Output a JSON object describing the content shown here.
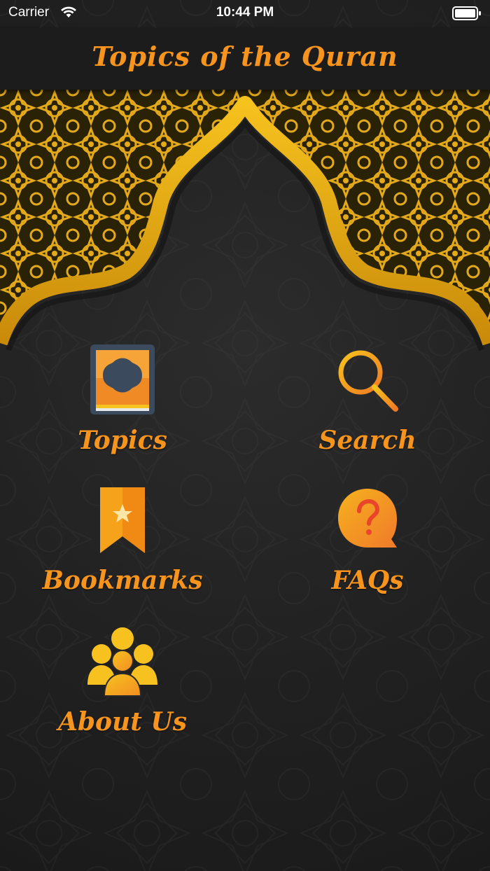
{
  "status_bar": {
    "carrier": "Carrier",
    "time": "10:44 PM",
    "wifi_icon": "wifi-icon",
    "battery_icon": "battery-icon"
  },
  "nav": {
    "title": "Topics of the Quran"
  },
  "menu": {
    "items": [
      {
        "label": "Topics",
        "icon": "book-icon"
      },
      {
        "label": "Search",
        "icon": "search-icon"
      },
      {
        "label": "Bookmarks",
        "icon": "bookmark-icon"
      },
      {
        "label": "FAQs",
        "icon": "question-bubble-icon"
      },
      {
        "label": "About Us",
        "icon": "people-icon"
      }
    ]
  },
  "colors": {
    "accent": "#f7941d",
    "gold": "#e8b020",
    "background": "#222222"
  }
}
